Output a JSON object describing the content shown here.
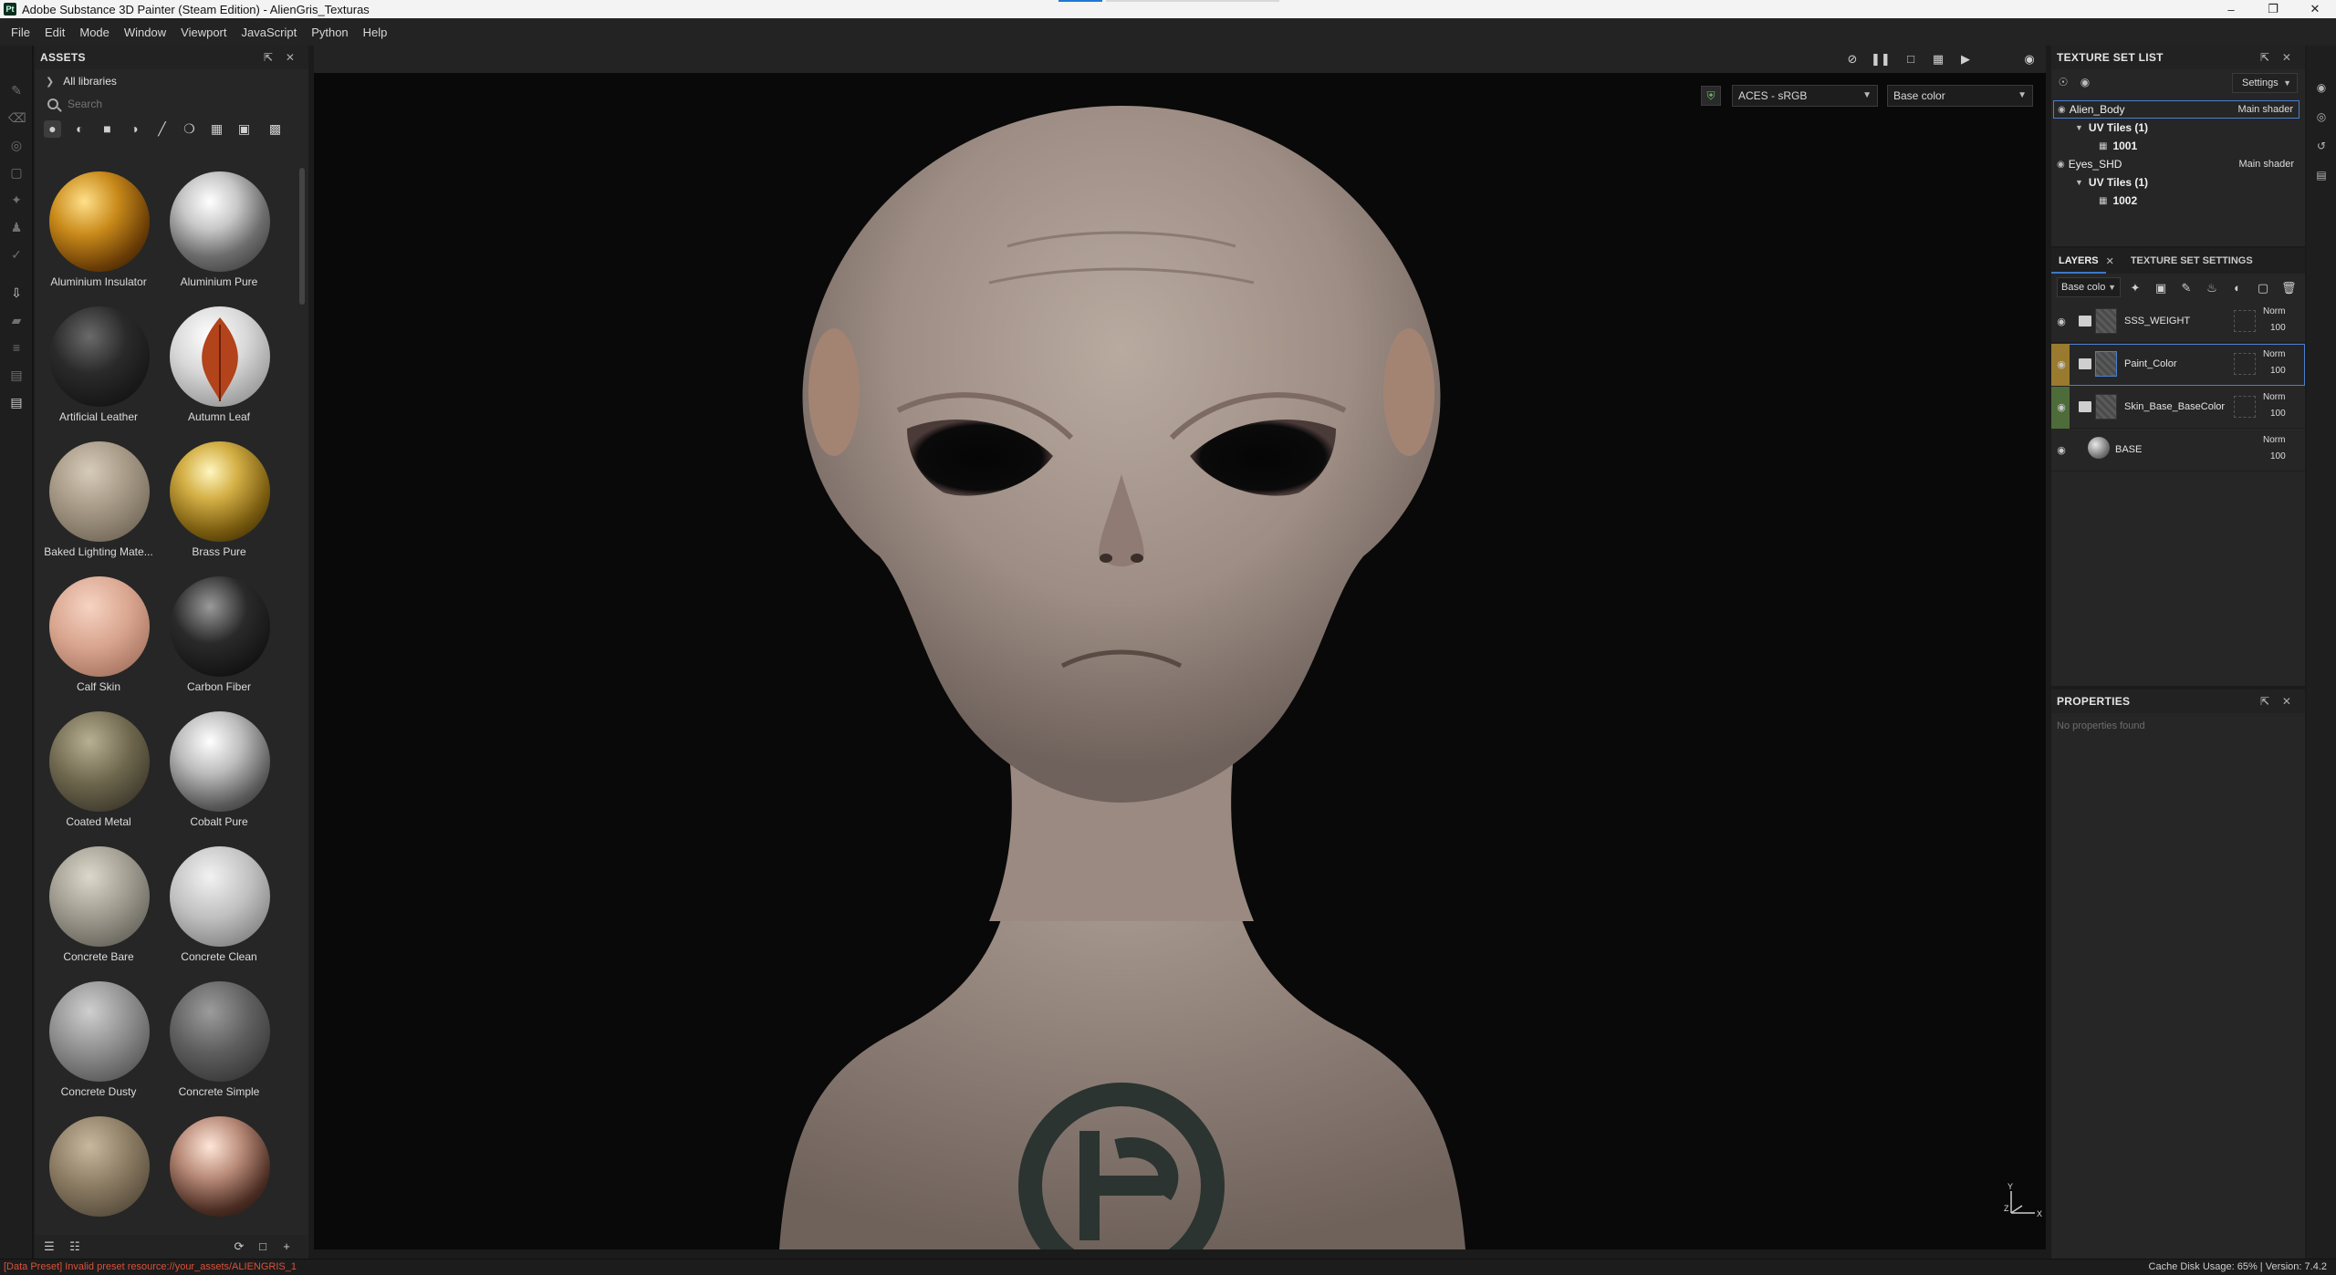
{
  "window": {
    "title": "Adobe Substance 3D Painter (Steam Edition) - AlienGris_Texturas",
    "app_icon": "Pt",
    "controls": [
      "minimize",
      "restore",
      "close"
    ]
  },
  "menu": [
    "File",
    "Edit",
    "Mode",
    "Window",
    "Viewport",
    "JavaScript",
    "Python",
    "Help"
  ],
  "assets": {
    "title": "ASSETS",
    "library": "All libraries",
    "search_placeholder": "Search",
    "items": [
      {
        "label": "Aluminium Insulator"
      },
      {
        "label": "Aluminium Pure"
      },
      {
        "label": "Artificial Leather"
      },
      {
        "label": "Autumn Leaf"
      },
      {
        "label": "Baked Lighting Mate..."
      },
      {
        "label": "Brass Pure"
      },
      {
        "label": "Calf Skin"
      },
      {
        "label": "Carbon Fiber"
      },
      {
        "label": "Coated Metal"
      },
      {
        "label": "Cobalt Pure"
      },
      {
        "label": "Concrete Bare"
      },
      {
        "label": "Concrete Clean"
      },
      {
        "label": "Concrete Dusty"
      },
      {
        "label": "Concrete Simple"
      },
      {
        "label": ""
      },
      {
        "label": ""
      }
    ]
  },
  "viewport": {
    "color_profile": "ACES - sRGB",
    "channel": "Base color",
    "axis": {
      "y": "Y",
      "z": "Z",
      "x": "X"
    }
  },
  "texture_set_list": {
    "title": "TEXTURE SET LIST",
    "settings_label": "Settings",
    "sets": [
      {
        "name": "Alien_Body",
        "shader": "Main shader",
        "uv_label": "UV Tiles (1)",
        "tile": "1001"
      },
      {
        "name": "Eyes_SHD",
        "shader": "Main shader",
        "uv_label": "UV Tiles (1)",
        "tile": "1002"
      }
    ]
  },
  "layers": {
    "tab_layers": "LAYERS",
    "tab_settings": "TEXTURE SET SETTINGS",
    "channel": "Base colo",
    "items": [
      {
        "name": "SSS_WEIGHT",
        "blend": "Norm",
        "opacity": "100",
        "color": ""
      },
      {
        "name": "Paint_Color",
        "blend": "Norm",
        "opacity": "100",
        "color": "#9a7a2e"
      },
      {
        "name": "Skin_Base_BaseColor",
        "blend": "Norm",
        "opacity": "100",
        "color": "#4e6b3a"
      },
      {
        "name": "BASE",
        "blend": "Norm",
        "opacity": "100",
        "color": ""
      }
    ]
  },
  "properties": {
    "title": "PROPERTIES",
    "empty": "No properties found"
  },
  "status": {
    "error": "[Data Preset] Invalid preset resource://your_assets/ALIENGRIS_1",
    "cache": "Cache Disk Usage:   65% | Version: 7.4.2"
  }
}
